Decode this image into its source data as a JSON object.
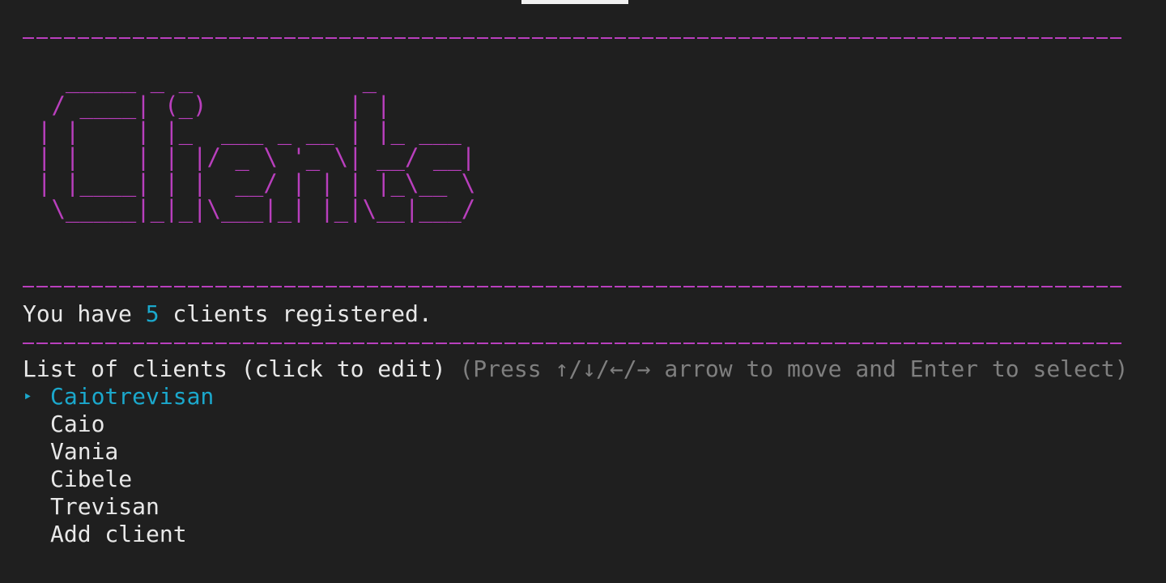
{
  "banner": {
    "ascii": "  _____ _ _            _\n / ____| (_)          | |\n| |    | |_  ___ _ __ | |_ ___\n| |    | | |/ _ \\ '_ \\| __/ __|\n| |____| | |  __/ | | | |_\\__ \\\n \\_____|_|_|\\___|_| |_|\\__|___/"
  },
  "summary": {
    "prefix": "You have ",
    "count": "5",
    "suffix": " clients registered."
  },
  "prompt": {
    "question": "List of clients (click to edit)",
    "hint": "(Press ↑/↓/←/→ arrow to move and Enter to select)"
  },
  "menu": {
    "pointer": "‣",
    "items": [
      {
        "label": "Caiotrevisan"
      },
      {
        "label": "Caio"
      },
      {
        "label": "Vania"
      },
      {
        "label": "Cibele"
      },
      {
        "label": "Trevisan"
      },
      {
        "label": "Add client"
      }
    ]
  },
  "colors": {
    "accent_magenta": "#b93fbd",
    "accent_cyan": "#1ba8cc",
    "hint_gray": "#7f7f7f",
    "background": "#1f1f1f"
  }
}
